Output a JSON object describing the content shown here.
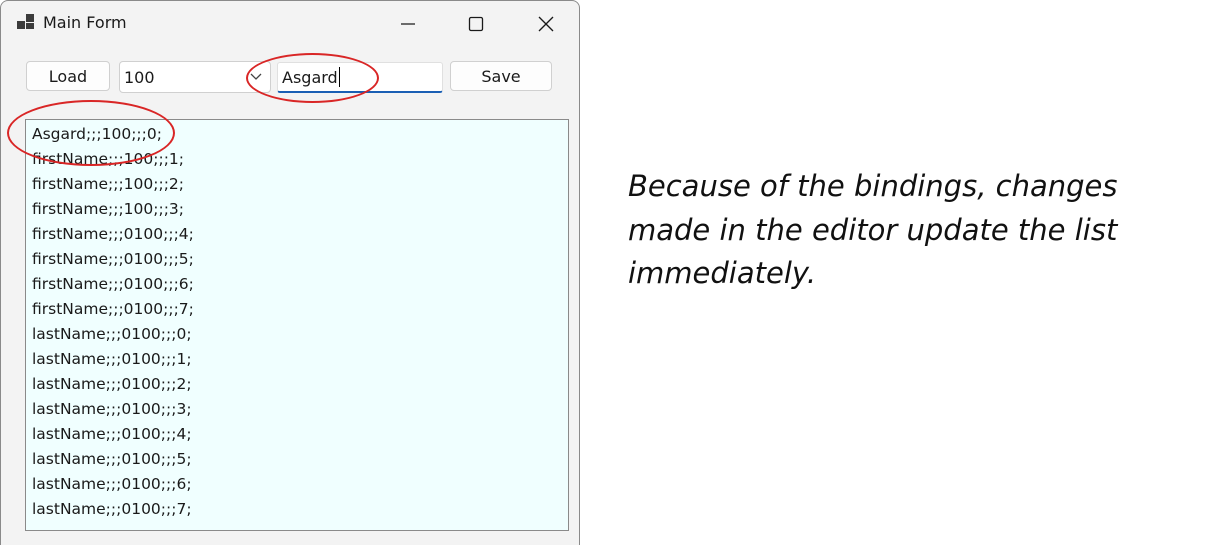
{
  "window": {
    "title": "Main Form",
    "controls": {
      "minimize": "minimize",
      "maximize": "maximize",
      "close": "close"
    }
  },
  "toolbar": {
    "load_label": "Load",
    "combo_value": "100",
    "text_value": "Asgard",
    "save_label": "Save"
  },
  "list": {
    "items": [
      "Asgard;;;100;;;0;",
      "firstName;;;100;;;1;",
      "firstName;;;100;;;2;",
      "firstName;;;100;;;3;",
      "firstName;;;0100;;;4;",
      "firstName;;;0100;;;5;",
      "firstName;;;0100;;;6;",
      "firstName;;;0100;;;7;",
      "lastName;;;0100;;;0;",
      "lastName;;;0100;;;1;",
      "lastName;;;0100;;;2;",
      "lastName;;;0100;;;3;",
      "lastName;;;0100;;;4;",
      "lastName;;;0100;;;5;",
      "lastName;;;0100;;;6;",
      "lastName;;;0100;;;7;"
    ]
  },
  "caption": {
    "lines": [
      "Because of the bindings, changes",
      "made in the editor update the list",
      "immediately."
    ]
  },
  "colors": {
    "annotation": "#d92626",
    "list_background": "#f0ffff",
    "focus_underline": "#1a5fb4"
  },
  "icons": [
    "app-icon",
    "minimize-icon",
    "maximize-icon",
    "close-icon",
    "chevron-down-icon"
  ]
}
